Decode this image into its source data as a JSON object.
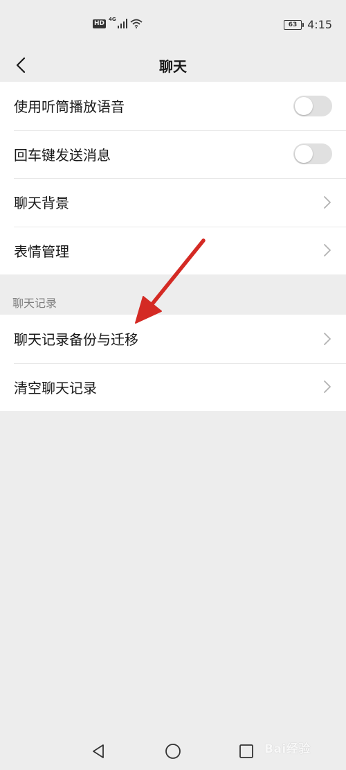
{
  "status_bar": {
    "hd_label": "HD",
    "network_label": "4G",
    "battery_level": "63",
    "time": "4:15"
  },
  "nav": {
    "title": "聊天"
  },
  "settings": {
    "group1": [
      {
        "label": "使用听筒播放语音",
        "control": "toggle",
        "on": false
      },
      {
        "label": "回车键发送消息",
        "control": "toggle",
        "on": false
      },
      {
        "label": "聊天背景",
        "control": "chevron"
      },
      {
        "label": "表情管理",
        "control": "chevron"
      }
    ],
    "section_header": "聊天记录",
    "group2": [
      {
        "label": "聊天记录备份与迁移",
        "control": "chevron"
      },
      {
        "label": "清空聊天记录",
        "control": "chevron"
      }
    ]
  },
  "watermark": {
    "text": "Bai经验"
  },
  "colors": {
    "background": "#ededed",
    "row_background": "#ffffff",
    "text_primary": "#191919",
    "text_secondary": "#7f7f7f",
    "toggle_off": "#e0e0e0",
    "chevron": "#b2b2b2",
    "annotation_arrow": "#d42a24"
  },
  "icons": {
    "back": "chevron-left-icon",
    "row_arrow": "chevron-right-icon",
    "system_back": "triangle-back-icon",
    "system_home": "circle-home-icon",
    "system_recent": "square-recent-icon"
  }
}
